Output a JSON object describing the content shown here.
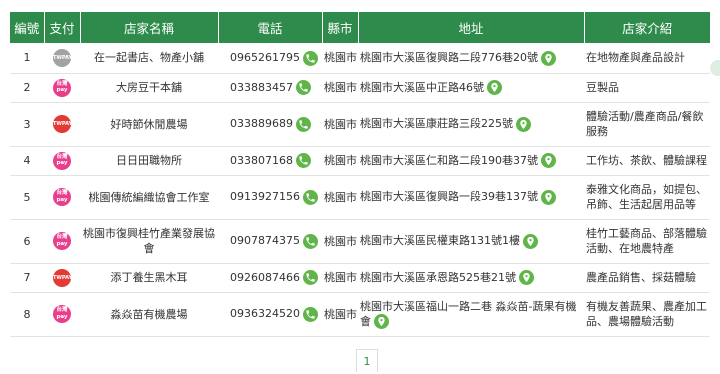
{
  "header": {
    "no": "編號",
    "pay": "支付",
    "shop": "店家名稱",
    "tel": "電話",
    "city": "縣市",
    "addr": "地址",
    "intro": "店家介紹"
  },
  "rows": [
    {
      "no": "1",
      "pay": "taiwan-pay-gray",
      "pay_text": "TWPAY",
      "shop": "在一起書店、物產小舖",
      "tel": "0965261795",
      "city": "桃園市",
      "addr": "桃園市大溪區復興路二段776巷20號",
      "intro": "在地物產與產品設計"
    },
    {
      "no": "2",
      "pay": "taiwan-pay-pink",
      "pay_text": "台灣 pay",
      "shop": "大房豆干本舖",
      "tel": "033883457",
      "city": "桃園市",
      "addr": "桃園市大溪區中正路46號",
      "intro": "豆製品"
    },
    {
      "no": "3",
      "pay": "taiwan-pay-red",
      "pay_text": "TWPAY",
      "shop": "好時節休閒農場",
      "tel": "033889689",
      "city": "桃園市",
      "addr": "桃園市大溪區康莊路三段225號",
      "intro": "體驗活動/農產商品/餐飲服務"
    },
    {
      "no": "4",
      "pay": "taiwan-pay-pink",
      "pay_text": "台灣 pay",
      "shop": "日日田職物所",
      "tel": "033807168",
      "city": "桃園市",
      "addr": "桃園市大溪區仁和路二段190巷37號",
      "intro": "工作坊、茶飲、體驗課程"
    },
    {
      "no": "5",
      "pay": "taiwan-pay-pink",
      "pay_text": "台灣 pay",
      "shop": "桃園傳統編織協會工作室",
      "tel": "0913927156",
      "city": "桃園市",
      "addr": "桃園市大溪區復興路一段39巷137號",
      "intro": "泰雅文化商品，如提包、吊飾、生活起居用品等"
    },
    {
      "no": "6",
      "pay": "taiwan-pay-pink",
      "pay_text": "台灣 pay",
      "shop": "桃園市復興桂竹產業發展協會",
      "tel": "0907874375",
      "city": "桃園市",
      "addr": "桃園市大溪區民權東路131號1樓",
      "intro": "桂竹工藝商品、部落體驗活動、在地農特產"
    },
    {
      "no": "7",
      "pay": "taiwan-pay-red",
      "pay_text": "TWPAY",
      "shop": "添丁養生黑木耳",
      "tel": "0926087466",
      "city": "桃園市",
      "addr": "桃園市大溪區承恩路525巷21號",
      "intro": "農產品銷售、採菇體驗"
    },
    {
      "no": "8",
      "pay": "taiwan-pay-pink",
      "pay_text": "台灣 pay",
      "shop": "淼焱苗有機農場",
      "tel": "0936324520",
      "city": "桃園市",
      "addr": "桃園市大溪區福山一路二巷 淼焱苗-蔬果有機會",
      "intro": "有機友善蔬果、農產加工品、農場體驗活動"
    }
  ],
  "row_heights": [
    "",
    "",
    "",
    "",
    "",
    "",
    "",
    ""
  ],
  "pagination": {
    "current": "1"
  },
  "colors": {
    "header_bg": "#2e8b4b",
    "icon_green": "#5fb548",
    "pay_pink": "#e83e8c",
    "pay_red": "#e53935",
    "pay_gray": "#a3a3a3"
  }
}
